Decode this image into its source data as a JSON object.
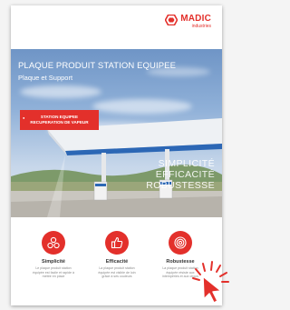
{
  "brand": {
    "name": "MADIC",
    "sub": "industries",
    "color": "#e3302b"
  },
  "hero": {
    "title": "PLAQUE PRODUIT STATION EQUIPEE",
    "subtitle": "Plaque et Support",
    "badge": {
      "line1": "STATION EQUIPEE",
      "line2": "RECUPERATION DE VAPEUR"
    },
    "tagline": [
      "SIMPLICITÉ",
      "EFFICACITÉ",
      "ROBUSTESSE"
    ]
  },
  "features": [
    {
      "icon": "molecules-icon",
      "name": "Simplicité",
      "desc": "Le plaque produit station équipée est facile et rapide à mettre en place"
    },
    {
      "icon": "thumbs-up-icon",
      "name": "Efficacité",
      "desc": "La plaque produit station équipée est visible de loin grâce à ses couleurs"
    },
    {
      "icon": "target-icon",
      "name": "Robustesse",
      "desc": "La plaque produit station équipée résiste aux intempéries et aux chocs"
    }
  ],
  "overlay": {
    "icon": "click-cursor-icon"
  }
}
